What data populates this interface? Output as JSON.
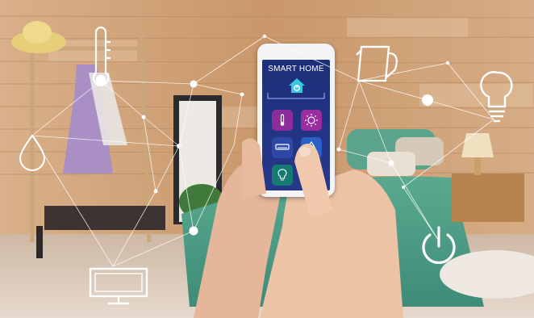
{
  "phone": {
    "title_smart": "SMART",
    "title_home": "HOME",
    "apps": [
      {
        "icon": "thermometer-icon",
        "color": "#8d2d9b"
      },
      {
        "icon": "sun-icon",
        "color": "#9a2ea0"
      },
      {
        "icon": "air-conditioner-icon",
        "color": "#2e48a8"
      },
      {
        "icon": "water-drop-icon",
        "color": "#2a5fc7"
      },
      {
        "icon": "light-bulb-icon",
        "color": "#147a72"
      },
      {
        "icon": "power-icon",
        "color": "#d6c72a"
      }
    ]
  },
  "network_icons": [
    "thermometer-icon",
    "water-drop-icon",
    "monitor-icon",
    "kettle-icon",
    "light-bulb-icon",
    "power-icon"
  ],
  "colors": {
    "wall": "#d2a77d",
    "bed": "#4fa08a",
    "screen": "#22347f",
    "accent": "#ffffff"
  }
}
